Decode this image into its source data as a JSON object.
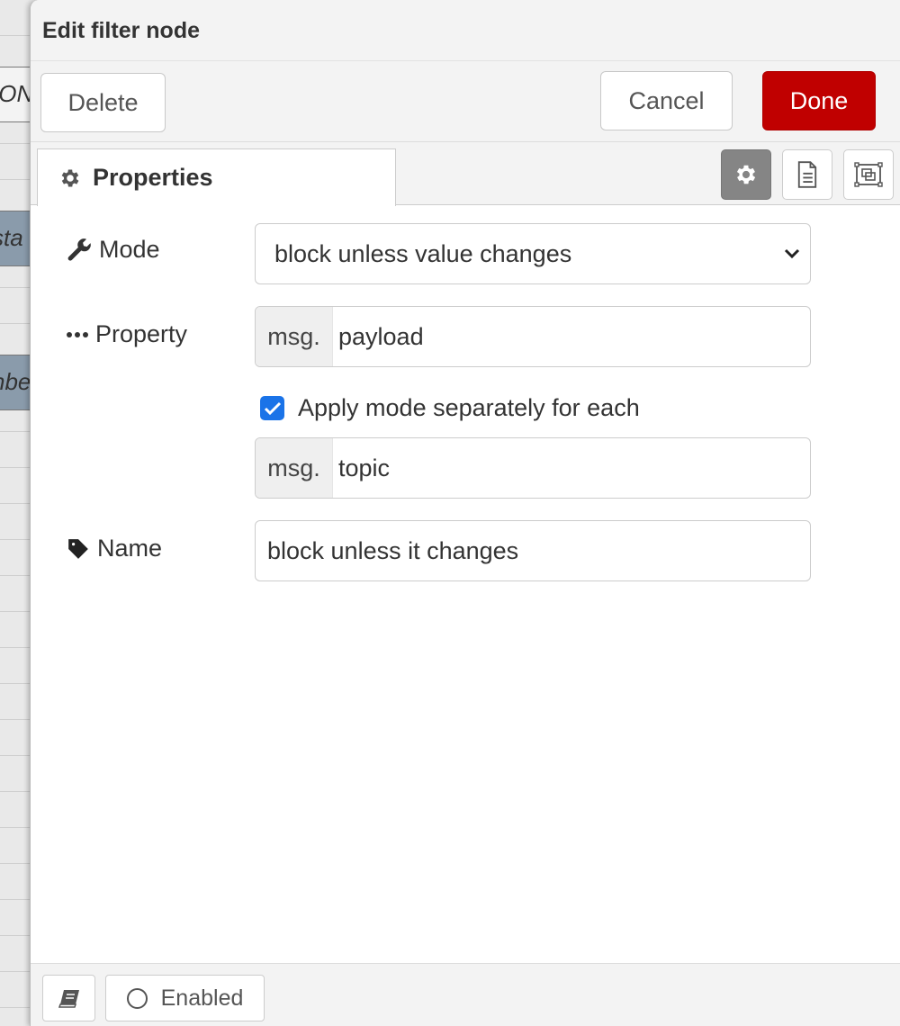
{
  "background": {
    "node_fragments": [
      "ION",
      "sta",
      "nbe"
    ]
  },
  "dialog": {
    "title": "Edit filter node",
    "toolbar": {
      "delete_label": "Delete",
      "cancel_label": "Cancel",
      "done_label": "Done"
    },
    "tabs": {
      "properties_label": "Properties",
      "icons": [
        "gear-icon",
        "document-icon",
        "node-appearance-icon"
      ],
      "active_icon": "gear-icon"
    },
    "form": {
      "mode": {
        "label": "Mode",
        "icon": "wrench-icon",
        "value": "block unless value changes"
      },
      "property": {
        "label": "Property",
        "icon": "ellipsis-icon",
        "prefix": "msg.",
        "value": "payload"
      },
      "apply_separately": {
        "label": "Apply mode separately for each",
        "checked": true
      },
      "topic": {
        "prefix": "msg.",
        "value": "topic"
      },
      "name": {
        "label": "Name",
        "icon": "tag-icon",
        "value": "block unless it changes"
      }
    },
    "footer": {
      "enabled_label": "Enabled",
      "icons": [
        "book-icon",
        "circle-icon"
      ]
    },
    "colors": {
      "done": "#c00000",
      "active_tab_icon": "#858585",
      "checkbox": "#1a73e8"
    }
  }
}
